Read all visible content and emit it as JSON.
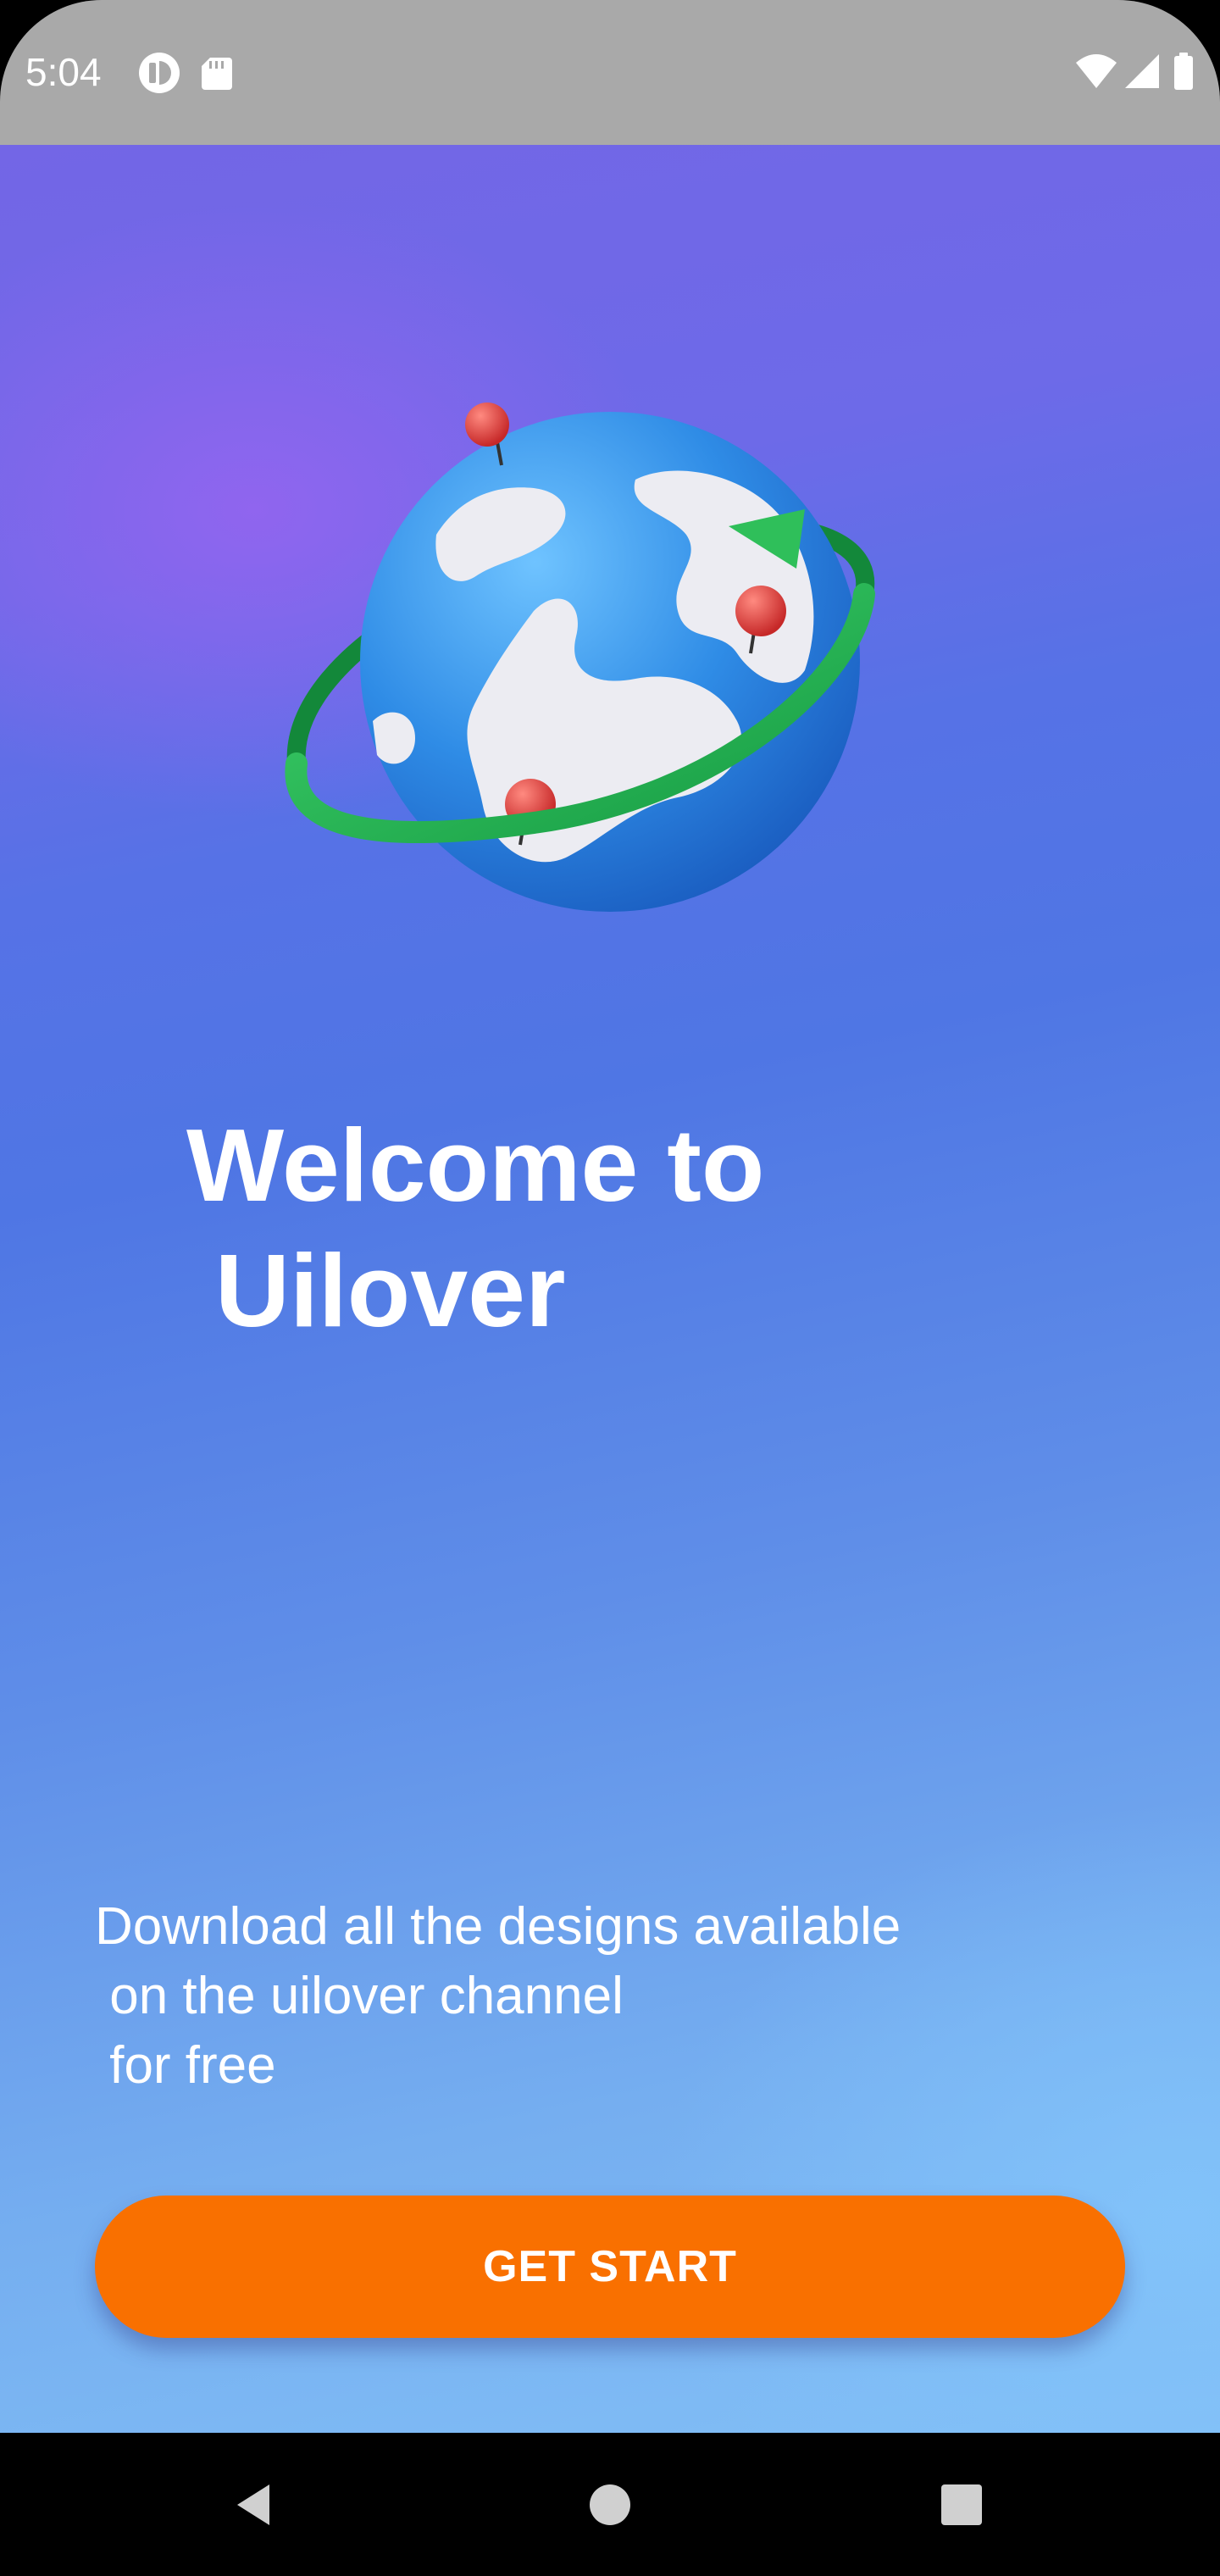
{
  "status_bar": {
    "time": "5:04",
    "left_icons": [
      "app-notification-icon",
      "sd-card-icon"
    ],
    "right_icons": [
      "wifi-icon",
      "cellular-signal-icon",
      "battery-icon"
    ]
  },
  "hero": {
    "image": "globe-illustration"
  },
  "welcome": {
    "title": "Welcome to\n Uilover"
  },
  "description": {
    "text": "Download all the designs available\n on the uilover channel\n for free"
  },
  "cta": {
    "label": "GET START",
    "color": "#f97000"
  },
  "nav_bar": {
    "buttons": [
      "back-icon",
      "home-icon",
      "recents-icon"
    ]
  },
  "colors": {
    "status_bar": "#a9a9a9",
    "gradient_top": "#7366e6",
    "gradient_mid": "#4f76e4",
    "gradient_bottom": "#82bff6",
    "text": "#ffffff"
  }
}
